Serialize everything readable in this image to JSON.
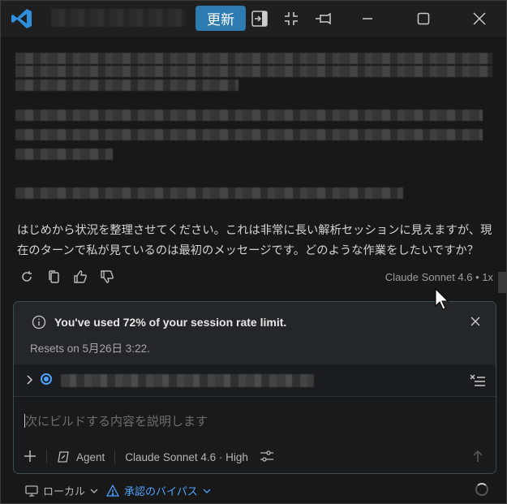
{
  "titlebar": {
    "update_label": "更新",
    "icons": [
      "vscode-logo",
      "toggle-panel-icon",
      "collapse-icon",
      "pin-icon",
      "minimize-icon",
      "maximize-icon",
      "close-icon"
    ]
  },
  "chat": {
    "response_text": "はじめから状況を整理させてください。これは非常に長い解析セッションに見えますが、現在のターンで私が見ているのは最初のメッセージです。どのような作業をしたいですか？",
    "model_info": "Claude Sonnet 4.6 • 1x"
  },
  "rate_limit": {
    "title": "You've used 72% of your session rate limit.",
    "resets": "Resets on 5月26日 3:22."
  },
  "composer": {
    "placeholder": "次にビルドする内容を説明します",
    "agent_label": "Agent",
    "model_label": "Claude Sonnet 4.6 · High"
  },
  "footer": {
    "local_label": "ローカル",
    "bypass_label": "承認のバイパス"
  },
  "colors": {
    "accent": "#2d7bb0",
    "link": "#4da3ff",
    "background": "#181818"
  }
}
